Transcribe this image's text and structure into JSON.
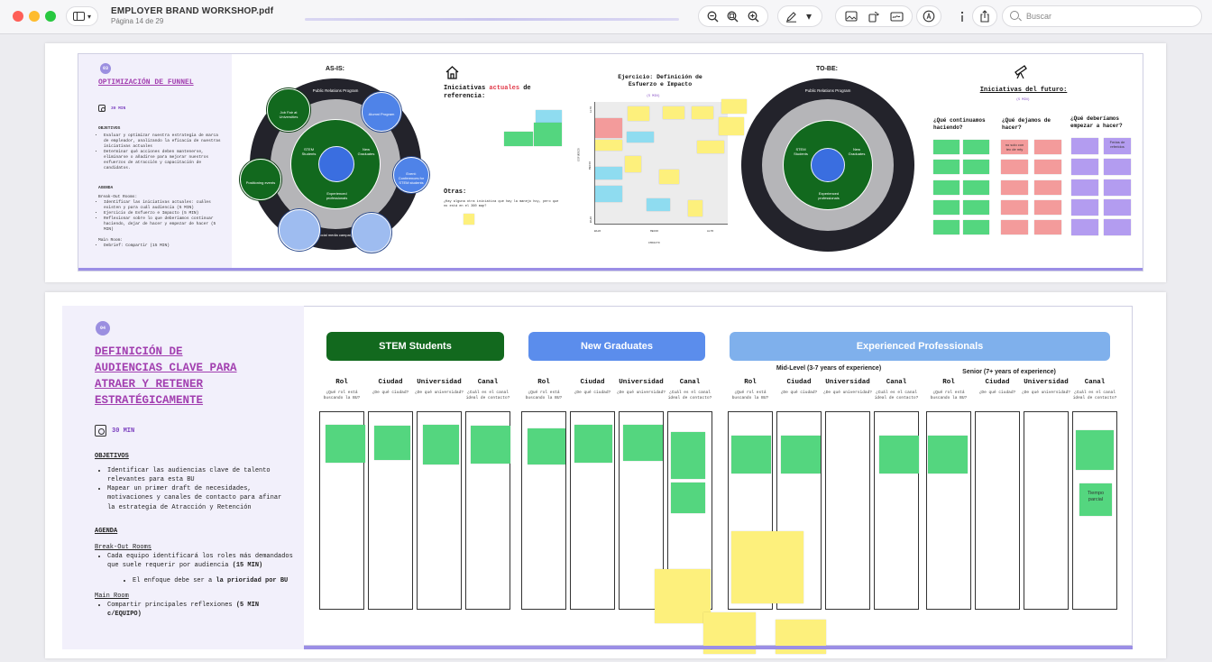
{
  "window": {
    "title": "EMPLOYER BRAND WORKSHOP.pdf",
    "page_indicator": "Página 14 de 29",
    "search_placeholder": "Buscar",
    "icons": [
      "sidebar-icon",
      "zoom-out-icon",
      "zoom-fit-icon",
      "zoom-in-icon",
      "highlight-pen-icon",
      "chevron-down-icon",
      "image-icon",
      "rotate-icon",
      "signature-icon",
      "markup-icon",
      "info-icon",
      "share-icon",
      "search-icon"
    ]
  },
  "slide1": {
    "badge": "03",
    "title": "OPTIMIZACIÓN DE FUNNEL",
    "time": "30 MIN",
    "objectives_heading": "OBJETIVOS",
    "objectives": [
      "Evaluar y optimizar nuestra estrategia de marca de empleador, analizando la eficacia de nuestras iniciativas actuales",
      "Determinar qué acciones deben mantenerse, eliminarse o añadirse para mejorar nuestros esfuerzos de atracción y capacitación de candidatos."
    ],
    "agenda_heading": "AGENDA",
    "breakout_label": "Break-Out Rooms:",
    "breakout_items": [
      "Identificar las iniciativas actuales: cuáles existen y para cuál audiencia (5 MIN)",
      "Ejercicio de Esfuerzo e Impacto (5 MIN)",
      "Reflexionar sobre lo que deberíamos continuar haciendo, dejar de hacer y empezar de hacer (5 MIN)"
    ],
    "main_room_label": "Main Room:",
    "main_room_items": [
      "Debrief: Compartir (15 MIN)"
    ],
    "as_is": {
      "label": "AS-IS:",
      "ring_title": "Public Relations Program",
      "center": "STEM Students",
      "right_segment": "New Graduates",
      "bottom_segment": "Experienced professionals",
      "bottom_outer": "Social media campaigns",
      "bubbles": [
        "Job Fair at Universities",
        "Alumni Program",
        "Positioning events",
        "Event: Conferences for STEM students"
      ]
    },
    "current": {
      "title_prefix": "Iniciativas",
      "title_highlight": "actuales",
      "title_suffix": "de referencia:",
      "otras_label": "Otras:",
      "otras_question": "¿Hay alguna otra iniciativa que hay la manejo hoy, pero que no está en el 360 map?"
    },
    "exercise": {
      "title": "Ejercicio: Definición de Esfuerzo e Impacto",
      "time": "(5 MIN)",
      "x_label": "IMPACTO",
      "y_label": "ESFUERZO",
      "x_ticks": [
        "BAJO",
        "MEDIO",
        "ALTO"
      ],
      "y_ticks": [
        "ALTO",
        "MEDIO",
        "BAJO"
      ]
    },
    "to_be": {
      "label": "TO-BE:",
      "ring_title": "Public Relations Program",
      "center": "STEM Students",
      "right_segment": "New Graduates",
      "bottom_segment": "Experienced professionals"
    },
    "future": {
      "title": "Iniciativas del futuro:",
      "time": "(5 MIN)",
      "col1": "¿Qué continuamos haciendo?",
      "col2": "¿Qué dejamos de hacer?",
      "col3": "¿Qué deberíamos empezar a hacer?",
      "sticky_red_1": "no solo con tec de mty",
      "sticky_purple_1": "Ferias de referidos"
    }
  },
  "slide2": {
    "badge": "04",
    "title_lines": [
      "DEFINICIÓN DE",
      "AUDIENCIAS CLAVE PARA",
      "ATRAER Y RETENER",
      "ESTRATÉGICAMENTE"
    ],
    "time": "30 MIN",
    "objectives_heading": "OBJETIVOS",
    "objectives": [
      "Identificar las audiencias  clave de talento relevantes para esta BU",
      "Mapear un primer draft de necesidades, motivaciones y canales de contacto para afinar la estrategia de Atracción y Retención"
    ],
    "agenda_heading": "AGENDA",
    "breakout_label": "Break-Out Rooms",
    "breakout_item": "Cada equipo identificará los roles más demandados que suele requerir por audiencia",
    "breakout_item_time": "(15 MIN)",
    "breakout_sub_prefix": "El enfoque debe ser a",
    "breakout_sub_bold": "la prioridad por BU",
    "main_room_label": "Main Room",
    "main_room_item": "Compartir principales reflexiones",
    "main_room_item_time": "(5 MIN c/EQUIPO)",
    "audiences": {
      "stem": {
        "label": "STEM Students",
        "color": "#12691e"
      },
      "grads": {
        "label": "New Graduates",
        "color": "#5b8dec"
      },
      "exp": {
        "label": "Experienced Professionals",
        "color": "#7fb0ec"
      }
    },
    "mid_level": "Mid-Level (3-7 years of experience)",
    "senior": "Senior (7+ years of experience)",
    "columns": [
      {
        "label": "Rol",
        "q": "¿Qué rol está buscando la BU?"
      },
      {
        "label": "Ciudad",
        "q": "¿De qué ciudad?"
      },
      {
        "label": "Universidad",
        "q": "¿De qué universidad?"
      },
      {
        "label": "Canal",
        "q": "¿Cuál es el canal ideal de contacto?"
      }
    ],
    "stickies": {
      "tiempo_parcial": "Tiempo parcial",
      "ferias_virtuales": "Ferias virtuales"
    }
  }
}
